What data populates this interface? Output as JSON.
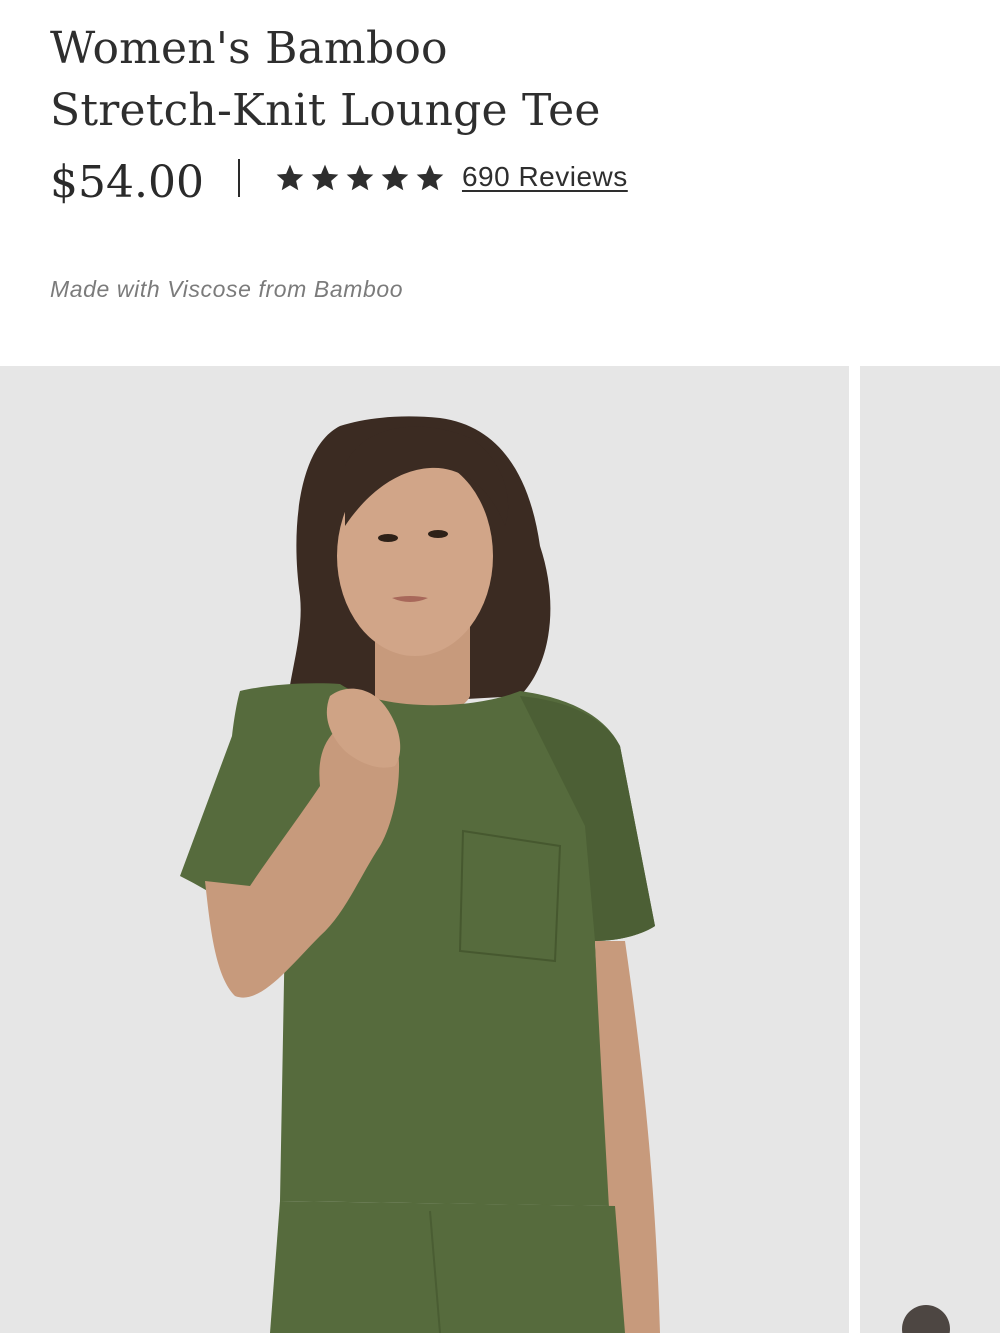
{
  "product": {
    "title_line1": "Women's Bamboo",
    "title_line2": "Stretch-Knit Lounge Tee",
    "price": "$54.00",
    "rating_stars": 5,
    "reviews_label": "690 Reviews",
    "tagline": "Made with Viscose from Bamboo"
  },
  "icons": {
    "star": "star-icon",
    "next": "next-arrow-icon"
  },
  "colors": {
    "text": "#2e2e2e",
    "muted": "#7b7b7b",
    "image_bg": "#e6e6e6",
    "tee": "#566b3d",
    "nav_button": "#4d4642"
  },
  "gallery": {
    "image_alt": "Model wearing olive green lounge tee",
    "next_slide_alt": "Next product image"
  }
}
